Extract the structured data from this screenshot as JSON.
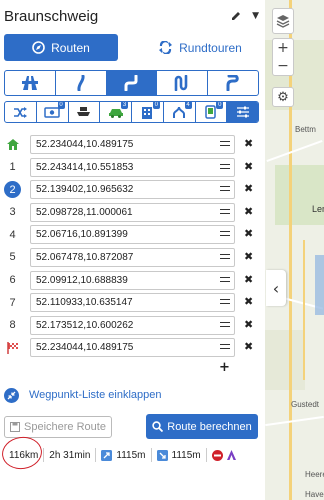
{
  "colors": {
    "accent": "#2e6dc7",
    "annotation": "#d0202a",
    "map_bg": "#eef0e6"
  },
  "header": {
    "title": "Braunschweig",
    "edit_icon": "pencil-icon",
    "menu_icon": "caret-down-icon"
  },
  "modes": [
    {
      "label": "Routen",
      "icon": "compass-icon",
      "active": true
    },
    {
      "label": "Rundtouren",
      "icon": "loop-arrows-icon",
      "active": false
    }
  ],
  "route_types": [
    {
      "icon": "highway-icon",
      "active": false
    },
    {
      "icon": "road-curve-icon",
      "active": false
    },
    {
      "icon": "road-winding-icon",
      "active": true
    },
    {
      "icon": "road-very-winding-icon",
      "active": false
    },
    {
      "icon": "road-extreme-curve-icon",
      "active": false
    }
  ],
  "avoid_options": [
    {
      "icon": "shuffle-icon",
      "badge": ""
    },
    {
      "icon": "toll-icon",
      "badge": "0"
    },
    {
      "icon": "ferry-icon",
      "badge": ""
    },
    {
      "icon": "car-icon",
      "badge": "3"
    },
    {
      "icon": "building-icon",
      "badge": "0"
    },
    {
      "icon": "merge-icon",
      "badge": "4"
    },
    {
      "icon": "phone-icon",
      "badge": "0"
    },
    {
      "icon": "sliders-icon",
      "badge": ""
    }
  ],
  "waypoints": [
    {
      "marker": "home",
      "label": "",
      "value": "52.234044,10.489175"
    },
    {
      "marker": "number",
      "label": "1",
      "value": "52.243414,10.551853"
    },
    {
      "marker": "selected",
      "label": "2",
      "value": "52.139402,10.965632"
    },
    {
      "marker": "number",
      "label": "3",
      "value": "52.098728,11.000061"
    },
    {
      "marker": "number",
      "label": "4",
      "value": "52.06716,10.891399"
    },
    {
      "marker": "number",
      "label": "5",
      "value": "52.067478,10.872087"
    },
    {
      "marker": "number",
      "label": "6",
      "value": "52.09912,10.688839"
    },
    {
      "marker": "number",
      "label": "7",
      "value": "52.110933,10.635147"
    },
    {
      "marker": "number",
      "label": "8",
      "value": "52.173512,10.600262"
    },
    {
      "marker": "flag",
      "label": "",
      "value": "52.234044,10.489175"
    }
  ],
  "add_label": "+",
  "collapse": {
    "label": "Wegpunkt-Liste einklappen"
  },
  "buttons": {
    "save": "Speichere Route",
    "calculate": "Route berechnen"
  },
  "stats": {
    "distance": "116km",
    "duration": "2h 31min",
    "ascent": "1115m",
    "descent": "1115m"
  },
  "map": {
    "labels": [
      "Bettm",
      "Lenge",
      "Gustedt",
      "Heere",
      "Haver"
    ],
    "zoom_in": "+",
    "zoom_out": "−",
    "expand": "‹"
  }
}
